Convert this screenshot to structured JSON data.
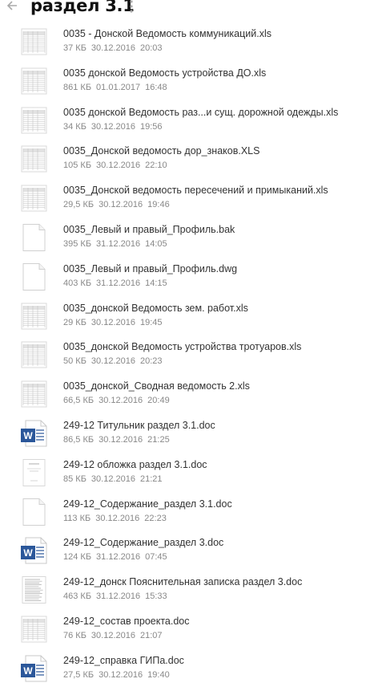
{
  "header": {
    "title": "раздел 3.1"
  },
  "files": [
    {
      "name": "0035 - Донской Ведомость коммуникаций.xls",
      "size": "37 КБ",
      "date": "30.12.2016",
      "time": "20:03",
      "thumb": "sheet"
    },
    {
      "name": "0035 донской Ведомость устройства ДО.xls",
      "size": "861 КБ",
      "date": "01.01.2017",
      "time": "16:48",
      "thumb": "sheet"
    },
    {
      "name": "0035 донской Ведомость раз...и сущ. дорожной одежды.xls",
      "size": "34 КБ",
      "date": "30.12.2016",
      "time": "19:56",
      "thumb": "sheet"
    },
    {
      "name": "0035_Донской ведомость дор_знаков.XLS",
      "size": "105 КБ",
      "date": "30.12.2016",
      "time": "22:10",
      "thumb": "sheet"
    },
    {
      "name": "0035_Донской ведомость пересечений и примыканий.xls",
      "size": "29,5 КБ",
      "date": "30.12.2016",
      "time": "19:46",
      "thumb": "sheet"
    },
    {
      "name": "0035_Левый и правый_Профиль.bak",
      "size": "395 КБ",
      "date": "31.12.2016",
      "time": "14:05",
      "thumb": "blank"
    },
    {
      "name": "0035_Левый и правый_Профиль.dwg",
      "size": "403 КБ",
      "date": "31.12.2016",
      "time": "14:15",
      "thumb": "blank"
    },
    {
      "name": "0035_донской Ведомость зем. работ.xls",
      "size": "29 КБ",
      "date": "30.12.2016",
      "time": "19:45",
      "thumb": "sheet"
    },
    {
      "name": "0035_донской Ведомость устройства тротуаров.xls",
      "size": "50 КБ",
      "date": "30.12.2016",
      "time": "20:23",
      "thumb": "sheet"
    },
    {
      "name": "0035_донской_Сводная ведомость 2.xls",
      "size": "66,5 КБ",
      "date": "30.12.2016",
      "time": "20:49",
      "thumb": "sheet"
    },
    {
      "name": "249-12 Титульник раздел 3.1.doc",
      "size": "86,5 КБ",
      "date": "30.12.2016",
      "time": "21:25",
      "thumb": "word"
    },
    {
      "name": "249-12 обложка раздел 3.1.doc",
      "size": "85 КБ",
      "date": "30.12.2016",
      "time": "21:21",
      "thumb": "cover"
    },
    {
      "name": "249-12_Содержание_раздел 3.1.doc",
      "size": "113 КБ",
      "date": "30.12.2016",
      "time": "22:23",
      "thumb": "blank"
    },
    {
      "name": "249-12_Содержание_раздел 3.doc",
      "size": "124 КБ",
      "date": "31.12.2016",
      "time": "07:45",
      "thumb": "word"
    },
    {
      "name": "249-12_донск Пояснительная записка раздел 3.doc",
      "size": "463 КБ",
      "date": "31.12.2016",
      "time": "15:33",
      "thumb": "text"
    },
    {
      "name": "249-12_состав проекта.doc",
      "size": "76 КБ",
      "date": "30.12.2016",
      "time": "21:07",
      "thumb": "sheet"
    },
    {
      "name": "249-12_справка ГИПа.doc",
      "size": "27,5 КБ",
      "date": "30.12.2016",
      "time": "19:40",
      "thumb": "word"
    }
  ],
  "colors": {
    "word_blue": "#2b579a",
    "title": "#111111",
    "meta": "#888888"
  }
}
